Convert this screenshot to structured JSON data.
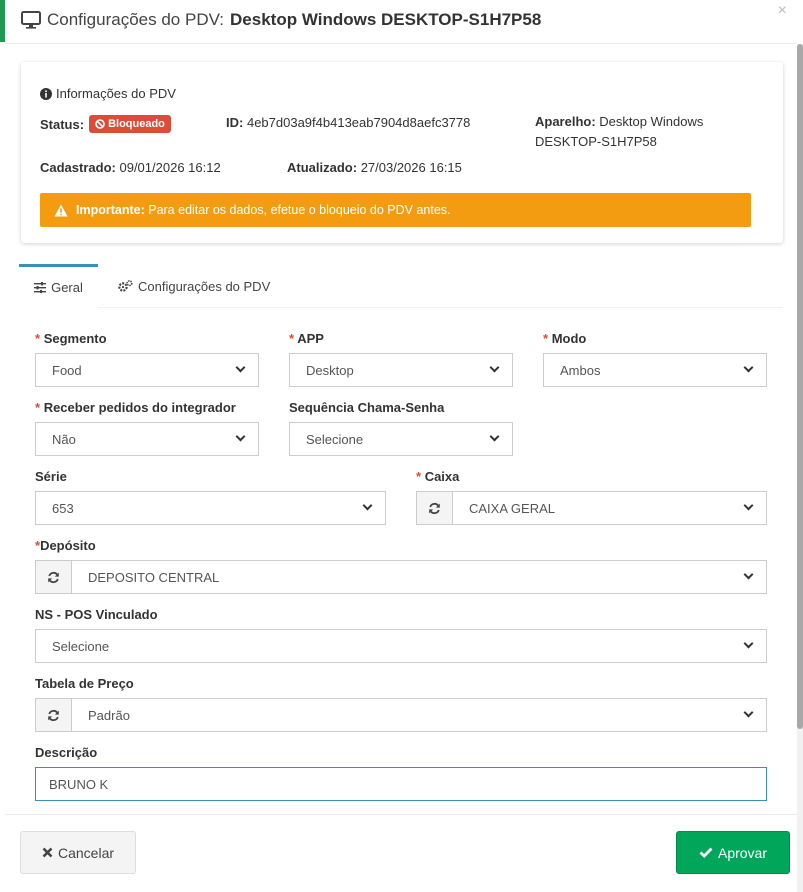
{
  "modal": {
    "title_prefix": "Configurações do PDV:",
    "title_device": "Desktop Windows DESKTOP-S1H7P58",
    "close_symbol": "×"
  },
  "info": {
    "title": "Informações do PDV",
    "status_label": "Status:",
    "status_value": "Bloqueado",
    "status_color": "#dd4b39",
    "id_label": "ID:",
    "id_value": "4eb7d03a9f4b413eab7904d8aefc3778",
    "aparelho_label": "Aparelho:",
    "aparelho_value": "Desktop Windows DESKTOP-S1H7P58",
    "cadastrado_label": "Cadastrado:",
    "cadastrado_value": "09/01/2026 16:12",
    "atualizado_label": "Atualizado:",
    "atualizado_value": "27/03/2026 16:15",
    "alert_strong": "Importante:",
    "alert_text": "Para editar os dados, efetue o bloqueio do PDV antes.",
    "alert_color": "#f39c12"
  },
  "tabs": [
    {
      "label": "Geral",
      "icon": "sliders-icon",
      "active": true
    },
    {
      "label": "Configurações do PDV",
      "icon": "cogs-icon",
      "active": false
    }
  ],
  "form": {
    "segmento": {
      "label": "Segmento",
      "required_mark": "*",
      "value": "Food"
    },
    "app": {
      "label": "APP",
      "required_mark": "*",
      "value": "Desktop"
    },
    "modo": {
      "label": "Modo",
      "required_mark": "*",
      "value": "Ambos"
    },
    "receber": {
      "label": "Receber pedidos do integrador",
      "required_mark": "*",
      "value": "Não"
    },
    "sequencia": {
      "label": "Sequência Chama-Senha",
      "value": "Selecione"
    },
    "serie": {
      "label": "Série",
      "value": "653"
    },
    "caixa": {
      "label": "Caixa",
      "required_mark": "*",
      "value": "CAIXA GERAL"
    },
    "deposito": {
      "label": "Depósito",
      "required_mark": "*",
      "value": "DEPOSITO CENTRAL"
    },
    "nspos": {
      "label": "NS - POS Vinculado",
      "value": "Selecione"
    },
    "tabela": {
      "label": "Tabela de Preço",
      "value": "Padrão"
    },
    "descricao": {
      "label": "Descrição",
      "value": "BRUNO K"
    }
  },
  "footer": {
    "cancel_label": "Cancelar",
    "approve_label": "Aprovar",
    "approve_color": "#00a65a"
  }
}
